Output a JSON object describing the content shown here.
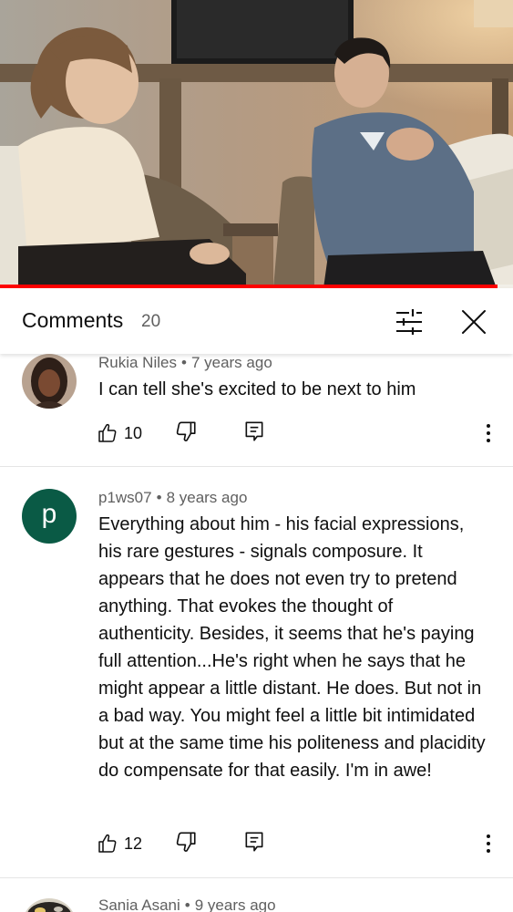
{
  "video": {
    "progress": 0.97,
    "progress_color": "#ff0000"
  },
  "header": {
    "title": "Comments",
    "count": "20",
    "filter_icon": "filter-sliders-icon",
    "close_icon": "close-icon"
  },
  "comments": [
    {
      "author": "Rukia Niles",
      "separator": "•",
      "time": "7 years ago",
      "text": "I can tell she's excited to be next to him",
      "likes": "10",
      "avatar": "photo"
    },
    {
      "author": "p1ws07",
      "separator": "•",
      "time": "8 years ago",
      "text": "Everything about him - his facial expressions, his rare gestures - signals composure. It appears that he does not even try to pretend anything. That evokes the thought of authenticity. Besides, it seems that he's paying full attention...He's right when he says that he might appear a little distant. He does. But not in a bad way. You might feel a little bit intimidated but at the same time his politeness and placidity do compensate for that easily. I'm in awe!",
      "likes": "12",
      "avatar_letter": "p",
      "avatar_color": "#0a5a45"
    },
    {
      "author": "Sania Asani",
      "separator": "•",
      "time": "9 years ago",
      "avatar": "photo"
    }
  ]
}
